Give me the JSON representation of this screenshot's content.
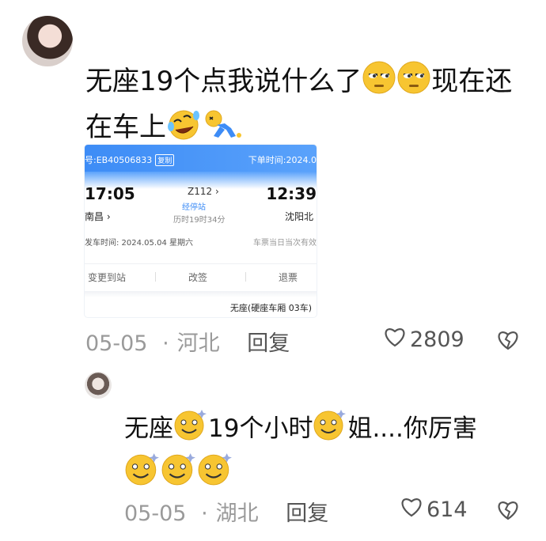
{
  "comments": [
    {
      "text_parts": [
        "无座19个点我说什么了",
        "现在还在车上"
      ],
      "emojis": [
        "unamused-emoji-icon",
        "unamused-emoji-icon",
        "rofl-emoji-icon",
        "collapsed-emoji-icon"
      ],
      "date": "05-05",
      "dot": "·",
      "location": "河北",
      "reply_label": "回复",
      "likes": "2809",
      "ticket": {
        "order_no": "号:EB40506833",
        "copy_label": "复制",
        "order_time": "下单时间:2024.0",
        "depart_time": "17:05",
        "depart_station": "南昌 ›",
        "train_no": "Z112 ›",
        "via_label": "经停站",
        "duration": "历时19时34分",
        "arrive_time": "12:39",
        "arrive_station": "沈阳北",
        "depart_date": "发车时间: 2024.05.04 星期六",
        "validity": "车票当日当次有效",
        "actions": [
          "变更到站",
          "改签",
          "退票"
        ],
        "seat": "无座(硬座车厢 03车)"
      }
    },
    {
      "text_parts": [
        "无座",
        "19个小时",
        "姐....你厉害"
      ],
      "emojis": [
        "dizzy-smile-emoji-icon",
        "dizzy-smile-emoji-icon",
        "dizzy-smile-emoji-icon",
        "dizzy-smile-emoji-icon",
        "dizzy-smile-emoji-icon"
      ],
      "date": "05-05",
      "dot": "·",
      "location": "湖北",
      "reply_label": "回复",
      "likes": "614"
    }
  ],
  "colors": {
    "accent": "#3d8cf6",
    "meta": "#9a9a9a",
    "emoji": "#f7c531"
  }
}
